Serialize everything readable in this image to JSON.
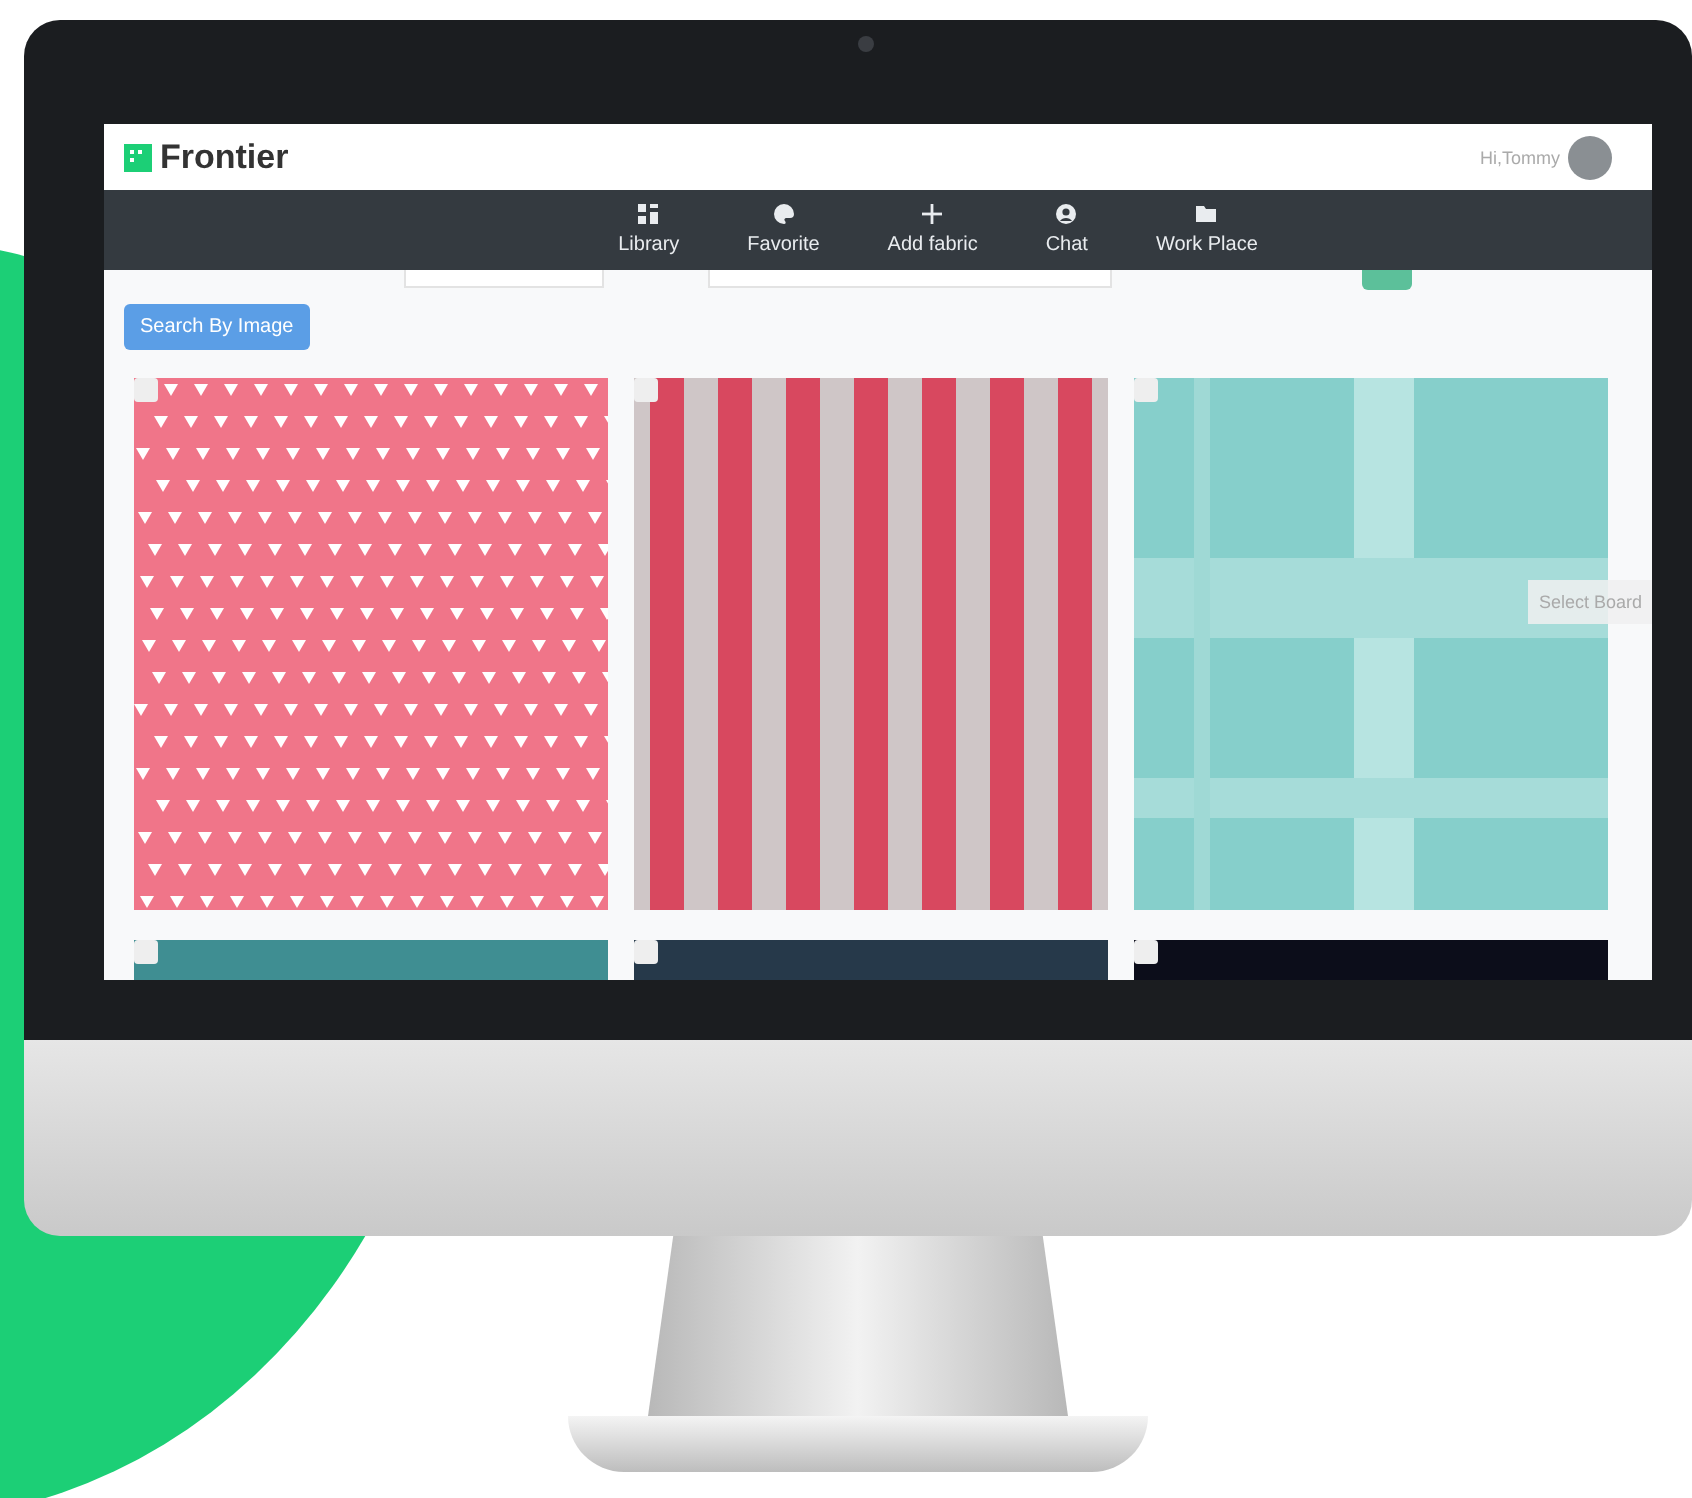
{
  "brand": "Frontier",
  "greeting": "Hi,Tommy",
  "nav": [
    {
      "label": "Library",
      "kind": "grid"
    },
    {
      "label": "Favorite",
      "kind": "palette"
    },
    {
      "label": "Add fabric",
      "kind": "plus"
    },
    {
      "label": "Chat",
      "kind": "user"
    },
    {
      "label": "Work Place",
      "kind": "folder"
    }
  ],
  "search_button": "Search By Image",
  "select_board": "Select Board",
  "fabrics": [
    {
      "kind": "triangles",
      "checked": false
    },
    {
      "kind": "stripes",
      "checked": false
    },
    {
      "kind": "plaid",
      "checked": false
    },
    {
      "kind": "teal",
      "checked": false
    },
    {
      "kind": "navy",
      "checked": false
    },
    {
      "kind": "black",
      "checked": false
    }
  ]
}
